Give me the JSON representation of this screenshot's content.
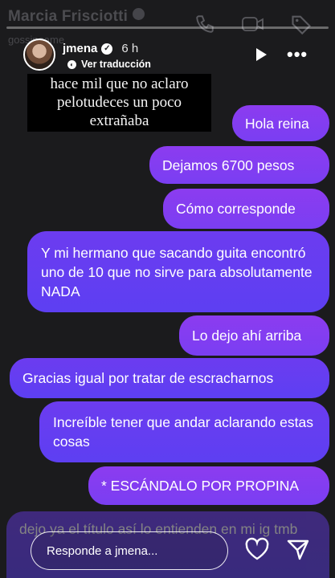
{
  "background": {
    "name": "Marcia Frisciotti",
    "handle": "gossipeame"
  },
  "story": {
    "progress": 0,
    "username": "jmena",
    "time": "6 h",
    "translate_label": "Ver traducción",
    "caption": "hace mil que no aclaro pelotudeces un poco extrañaba"
  },
  "messages": [
    {
      "side": "right",
      "text": "Hola reina"
    },
    {
      "side": "right",
      "text": "Dejamos 6700 pesos"
    },
    {
      "side": "right",
      "text": "Cómo corresponde"
    },
    {
      "side": "left",
      "text": "Y mi hermano que sacando guita encontró uno de 10 que no sirve para absolutamente NADA"
    },
    {
      "side": "right",
      "text": "Lo dejo ahí arriba"
    },
    {
      "side": "left",
      "text": "Gracias igual por tratar de escracharnos"
    },
    {
      "side": "left",
      "text": "Increíble tener que andar aclarando estas cosas"
    },
    {
      "side": "right",
      "text": "* ESCÁNDALO POR PROPINA"
    }
  ],
  "bottom": {
    "partial_text": "dejo ya el título así lo entienden en mi ig tmb",
    "reply_placeholder": "Responde a jmena..."
  },
  "icons": {
    "verified": "verified-badge-icon",
    "phone": "phone-icon",
    "video": "video-camera-icon",
    "tag": "tag-icon",
    "play": "play-icon",
    "more": "more-options-icon",
    "heart": "heart-icon",
    "send": "send-icon"
  },
  "colors": {
    "bubble_right": "#8c3cf0",
    "bubble_left": "#6c3cf0",
    "background": "#1b1b1d"
  }
}
